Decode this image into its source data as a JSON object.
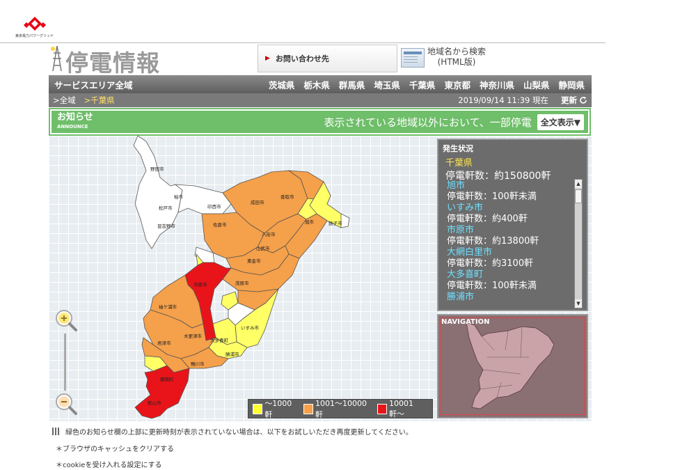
{
  "header": {
    "logo_text": "東京電力パワーグリッド",
    "page_title": "停電情報",
    "contact_label": "お問い合わせ先",
    "search_label_line1": "地域名から検索",
    "search_label_line2": "(HTML版)"
  },
  "nav": {
    "all_area": "サービスエリア全域",
    "prefectures": [
      "茨城県",
      "栃木県",
      "群馬県",
      "埼玉県",
      "千葉県",
      "東京都",
      "神奈川県",
      "山梨県",
      "静岡県"
    ]
  },
  "breadcrumb": {
    "all": ">全域",
    "current": ">千葉県",
    "timestamp": "2019/09/14 11:39 現在",
    "refresh": "更新"
  },
  "announce": {
    "title": "お知らせ",
    "subtitle": "ANNOUNCE",
    "message": "表示されている地域以外において、一部停電",
    "show_all": "全文表示▼"
  },
  "status": {
    "heading": "発生状況",
    "prefecture": "千葉県",
    "total": "停電軒数：約150800軒",
    "cities": [
      {
        "name": "旭市",
        "count": "停電軒数：100軒未満"
      },
      {
        "name": "いすみ市",
        "count": "停電軒数：約400軒"
      },
      {
        "name": "市原市",
        "count": "停電軒数：約13800軒"
      },
      {
        "name": "大網白里市",
        "count": "停電軒数：約3100軒"
      },
      {
        "name": "大多喜町",
        "count": "停電軒数：100軒未満"
      },
      {
        "name": "勝浦市",
        "count": ""
      }
    ]
  },
  "navigation": {
    "label": "NAVIGATION"
  },
  "legend": {
    "items": [
      {
        "label": "〜1000軒",
        "color": "#ffff33"
      },
      {
        "label": "1001〜10000軒",
        "color": "#f5a04a"
      },
      {
        "label": "10001軒〜",
        "color": "#e8141a"
      }
    ]
  },
  "map_labels": {
    "noda": "野田市",
    "kashiwa": "柏市",
    "matsudo": "松戸市",
    "narashino": "習志野市",
    "inzai": "印西市",
    "narita": "成田市",
    "katori": "香取市",
    "sawara": "佐倉市",
    "yachimata": "八街市",
    "sanmu": "山武市",
    "choshi": "銚子市",
    "asahi": "旭市",
    "togane": "東金市",
    "ichihara": "市原市",
    "mobara": "茂原市",
    "kisarazu": "木更津市",
    "kimitsu": "君津市",
    "futtsu": "富津市",
    "otaki": "大多喜町",
    "isumi": "いすみ市",
    "katsuura": "勝浦市",
    "kamogawa": "鴨川市",
    "minamiboso": "南房総市",
    "tateyama": "館山市",
    "kyonan": "鋸南町",
    "sodegaura": "袖ケ浦市"
  },
  "footer": {
    "note": "緑色のお知らせ欄の上部に更新時刻が表示されていない場合は、以下をお試しいただき再度更新してください。",
    "bullet1": "＊ブラウザのキャッシュをクリアする",
    "bullet2": "＊cookieを受け入れる設定にする"
  }
}
